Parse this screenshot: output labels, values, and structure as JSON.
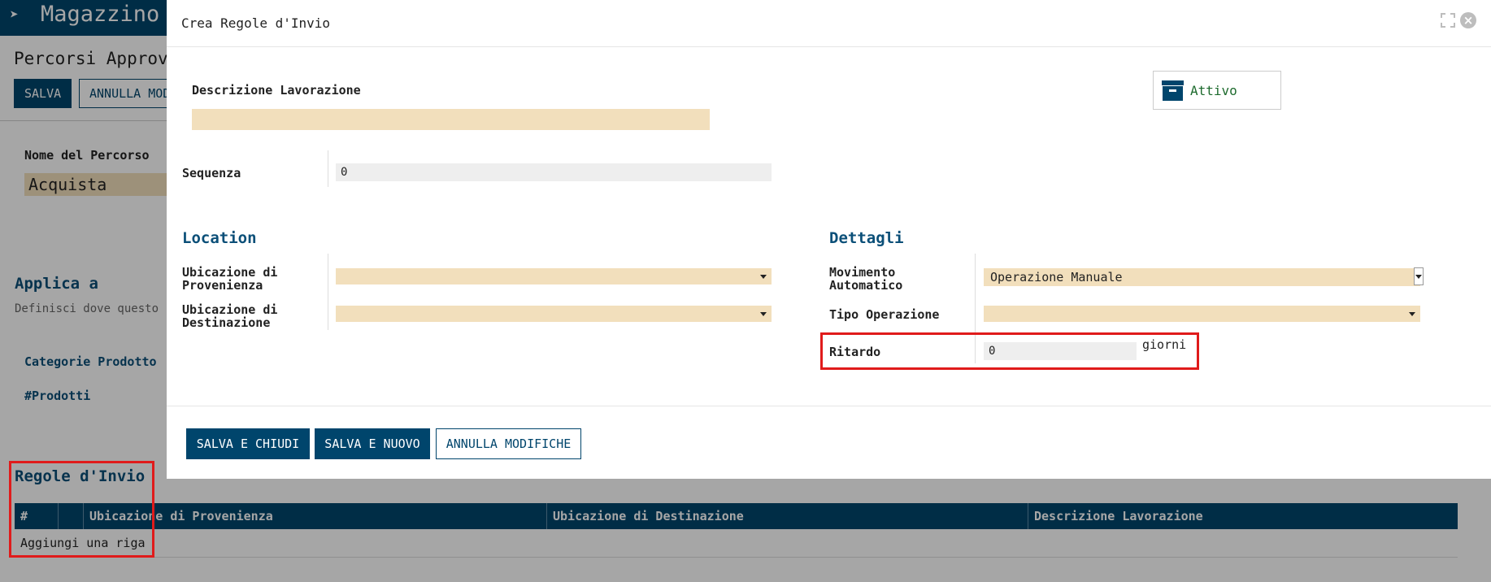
{
  "background": {
    "app_title": "Magazzino",
    "page_title": "Percorsi Approv",
    "buttons": {
      "save": "SALVA",
      "discard": "ANNULLA MOD"
    },
    "route_name_label": "Nome del Percorso",
    "route_name_value": "Acquista",
    "apply_to_title": "Applica a",
    "apply_to_help": "Definisci dove questo",
    "links": [
      "Categorie Prodotto",
      "#Prodotti"
    ],
    "rules_title": "Regole d'Invio",
    "table": {
      "columns": [
        "#",
        "",
        "Ubicazione di Provenienza",
        "Ubicazione di Destinazione",
        "Descrizione Lavorazione"
      ],
      "add_row": "Aggiungi una riga"
    }
  },
  "modal": {
    "title": "Crea Regole d'Invio",
    "description": {
      "label": "Descrizione Lavorazione",
      "value": ""
    },
    "active_button": "Attivo",
    "sequence": {
      "label": "Sequenza",
      "value": "0"
    },
    "location": {
      "title": "Location",
      "source": {
        "label_line1": "Ubicazione di",
        "label_line2": "Provenienza",
        "value": ""
      },
      "destination": {
        "label_line1": "Ubicazione di",
        "label_line2": "Destinazione",
        "value": ""
      }
    },
    "details": {
      "title": "Dettagli",
      "auto_move": {
        "label_line1": "Movimento",
        "label_line2": "Automatico",
        "value": "Operazione Manuale"
      },
      "operation_type": {
        "label": "Tipo Operazione",
        "value": ""
      },
      "delay": {
        "label": "Ritardo",
        "value": "0",
        "unit": "giorni"
      }
    },
    "footer": {
      "save_close": "SALVA E CHIUDI",
      "save_new": "SALVA E NUOVO",
      "discard": "ANNULLA MODIFICHE"
    }
  },
  "colors": {
    "brand": "#00456c",
    "required_field": "#f2dfbc",
    "section_title": "#0b4f78",
    "active_text": "#1e6b2e",
    "highlight": "#e01b1b"
  }
}
